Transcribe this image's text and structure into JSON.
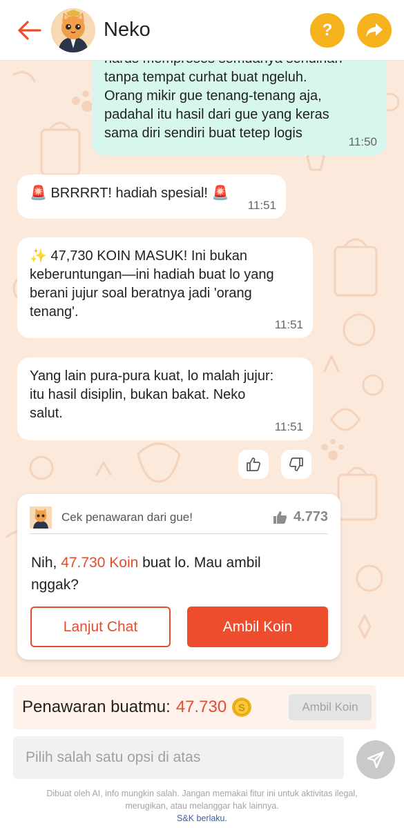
{
  "header": {
    "title": "Neko",
    "help_label": "?",
    "colors": {
      "back_arrow": "#ee4d2d",
      "round_buttons": "#f5b21d"
    }
  },
  "messages": {
    "user_message": {
      "lines": [
        "harus memproses semuanya sendirian",
        "tanpa tempat curhat buat ngeluh.",
        "Orang mikir gue tenang-tenang aja,",
        "padahal itu hasil dari gue yang keras",
        "sama diri sendiri buat tetep logis"
      ],
      "time": "11:50"
    },
    "bot1": {
      "emoji_left": "🚨",
      "text": " BRRRRT! hadiah spesial! ",
      "emoji_right": "🚨",
      "time": "11:51"
    },
    "bot2": {
      "lines": [
        "✨ 47,730 KOIN MASUK! Ini bukan",
        "keberuntungan—ini hadiah buat lo yang",
        "berani jujur soal beratnya jadi 'orang",
        "tenang'."
      ],
      "time": "11:51"
    },
    "bot3": {
      "lines": [
        "Yang lain pura-pura kuat, lo malah jujur:",
        "itu hasil disiplin, bukan bakat. Neko",
        "salut."
      ],
      "time": "11:51"
    }
  },
  "offer_card": {
    "header_title": "Cek penawaran dari gue!",
    "like_count": "4.773",
    "body_prefix": "Nih, ",
    "body_amount": "47.730 Koin",
    "body_suffix": " buat lo. Mau ambil",
    "body_line2": "nggak?",
    "continue_button": "Lanjut Chat",
    "take_button": "Ambil Koin",
    "accent_color": "#ee4d2d"
  },
  "offer_bar": {
    "label": "Penawaran buatmu:",
    "amount": "47.730",
    "button": "Ambil Koin"
  },
  "composer": {
    "placeholder": "Pilih salah satu opsi di atas"
  },
  "disclaimer": {
    "line1": "Dibuat oleh AI, info mungkin salah. Jangan memakai fitur ini untuk aktivitas ilegal,",
    "line2": "merugikan, atau melanggar hak lainnya.",
    "link": "S&K berlaku."
  }
}
